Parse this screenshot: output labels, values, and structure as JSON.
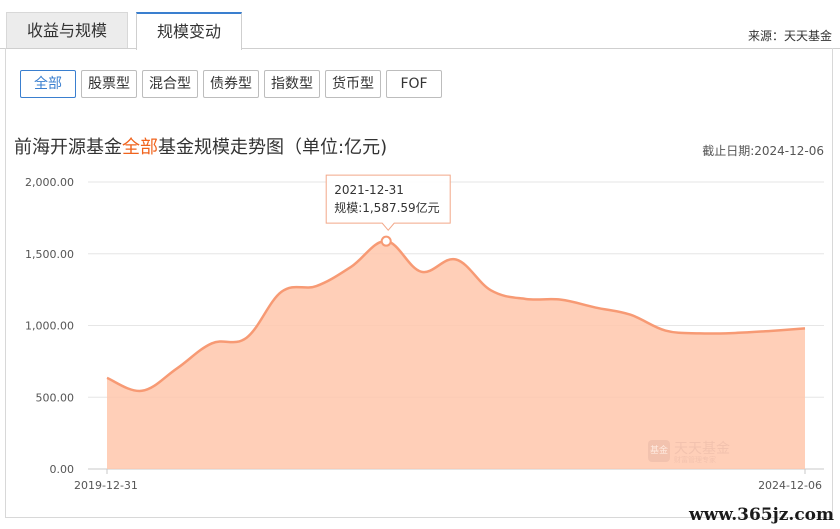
{
  "tabs": [
    "收益与规模",
    "规模变动"
  ],
  "source": "来源：天天基金",
  "filters": [
    "全部",
    "股票型",
    "混合型",
    "债券型",
    "指数型",
    "货币型",
    "FOF"
  ],
  "title": {
    "prefix": "前海开源基金",
    "highlight": "全部",
    "suffix": "基金规模走势图（单位:亿元)"
  },
  "deadline": "截止日期:2024-12-06",
  "watermark": {
    "site": "www.365jz.com",
    "logo_badge": "基金",
    "logo_name": "天天基金",
    "logo_sub": "财富管理专家"
  },
  "colors": {
    "accent": "#3a7fcf",
    "highlight": "#f0641e",
    "area_fill": "#ffc7ab",
    "area_line": "#f79a74"
  },
  "chart_data": {
    "type": "area",
    "x": [
      "2019-12-31",
      "2020-03-31",
      "2020-06-30",
      "2020-09-30",
      "2020-12-31",
      "2021-03-31",
      "2021-06-30",
      "2021-09-30",
      "2021-12-31",
      "2022-03-31",
      "2022-06-30",
      "2022-09-30",
      "2022-12-31",
      "2023-03-31",
      "2023-06-30",
      "2023-09-30",
      "2023-12-31",
      "2024-03-31",
      "2024-06-30",
      "2024-09-30",
      "2024-12-06"
    ],
    "x_tick_labels": [
      "2019-12-31",
      "2024-12-06"
    ],
    "series": [
      {
        "values": [
          635,
          545,
          700,
          875,
          915,
          1235,
          1275,
          1410,
          1587.59,
          1375,
          1460,
          1245,
          1185,
          1180,
          1125,
          1075,
          965,
          945,
          948,
          962,
          980
        ]
      }
    ],
    "ylim": [
      0,
      2000
    ],
    "y_ticks": [
      "0.00",
      "500.00",
      "1,000.00",
      "1,500.00",
      "2,000.00"
    ],
    "grid": true,
    "tooltip": {
      "date": "2021-12-31",
      "label": "规模:1,587.59亿元",
      "index": 8
    }
  }
}
